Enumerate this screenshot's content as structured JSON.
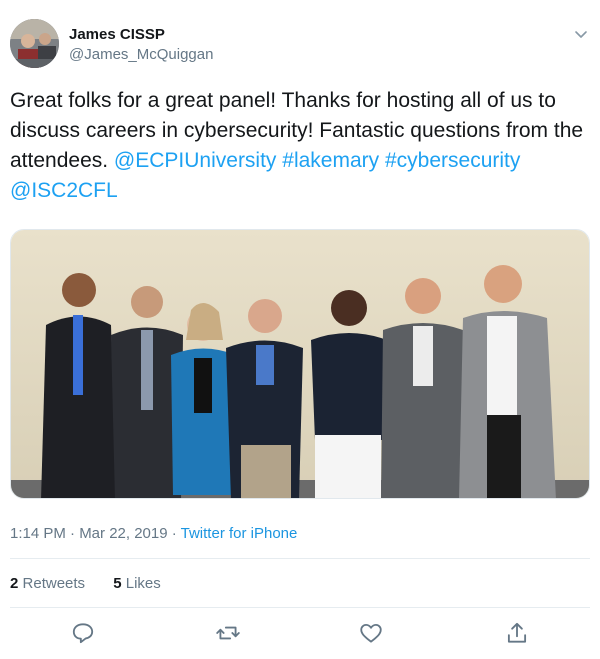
{
  "tweet": {
    "author": {
      "display_name": "James CISSP",
      "handle": "@James_McQuiggan"
    },
    "text_parts": {
      "plain": "Great folks for a great panel!  Thanks for hosting all of us to discuss careers in cybersecurity!  Fantastic questions from the attendees. ",
      "mention1": "@ECPIUniversity",
      "hashtag1": "#lakemary",
      "hashtag2": "#cybersecurity",
      "mention2": "@ISC2CFL"
    },
    "timestamp": "1:14 PM · Mar 22, 2019 · ",
    "source": "Twitter for iPhone",
    "stats": {
      "retweets_count": "2",
      "retweets_label": "Retweets",
      "likes_count": "5",
      "likes_label": "Likes"
    }
  },
  "icons": {
    "caret": "chevron-down-icon",
    "reply": "reply-icon",
    "retweet": "retweet-icon",
    "like": "heart-icon",
    "share": "share-icon"
  },
  "colors": {
    "link": "#1da1f2",
    "secondary_text": "#657786",
    "divider": "#e6ecf0"
  }
}
